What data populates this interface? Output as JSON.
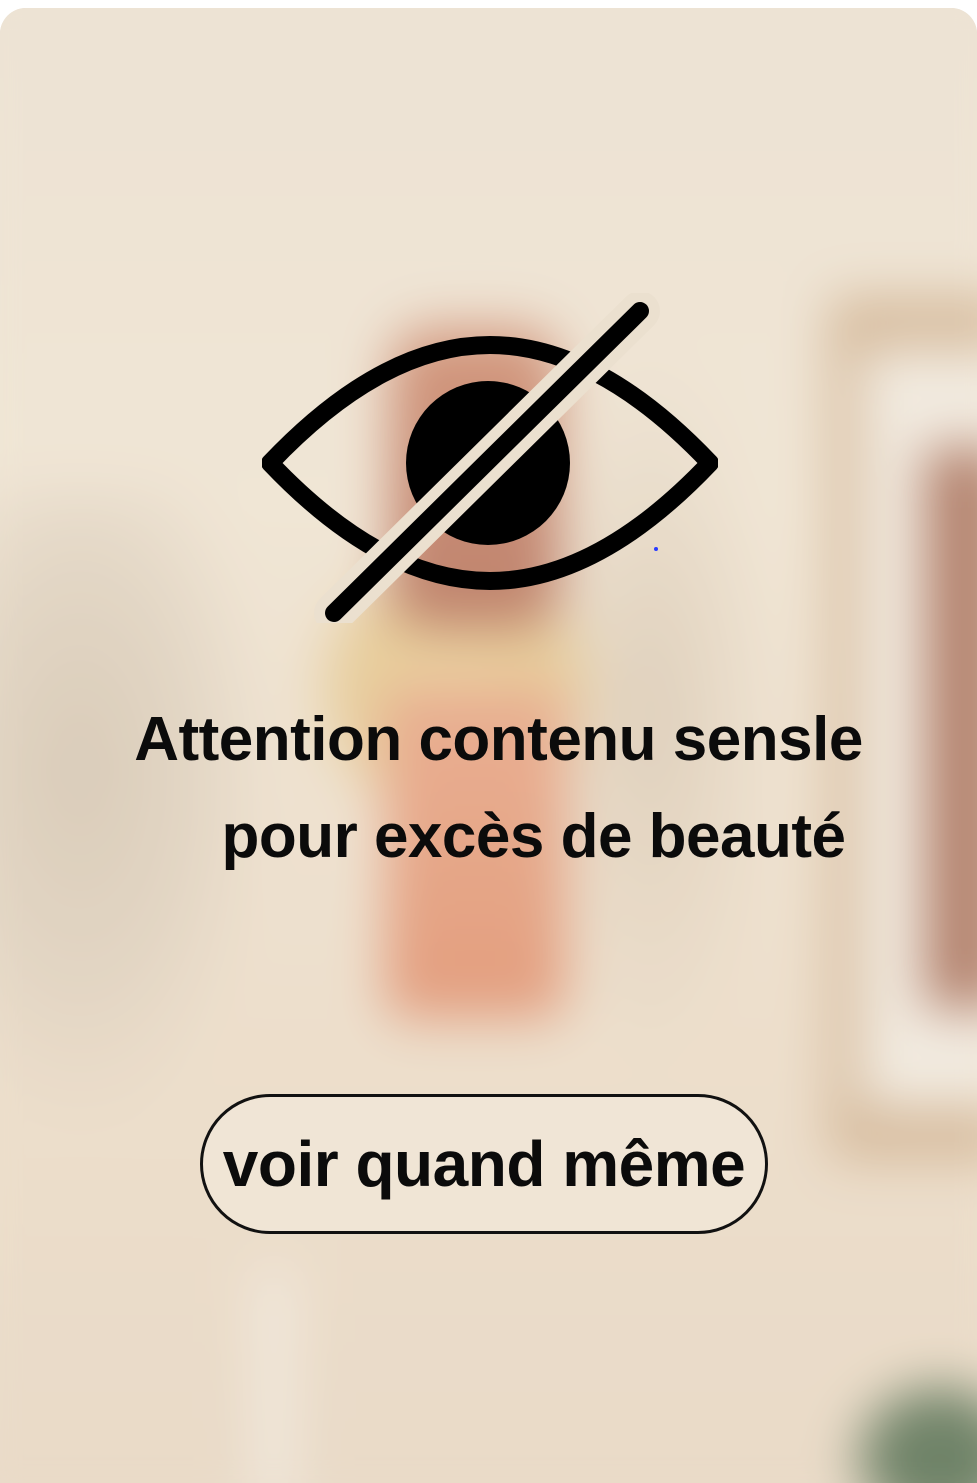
{
  "overlay": {
    "title_line1": "Attention contenu sensle",
    "title_line2": "pour excès de beauté",
    "reveal_label": "voir quand même",
    "icon": "eye-slash-icon"
  },
  "colors": {
    "text": "#0b0b0b",
    "button_border": "#111111",
    "backdrop_wall": "#eadfcf",
    "lamp_terracotta": "#e08a64",
    "lamp_brass": "#e2c07e"
  }
}
